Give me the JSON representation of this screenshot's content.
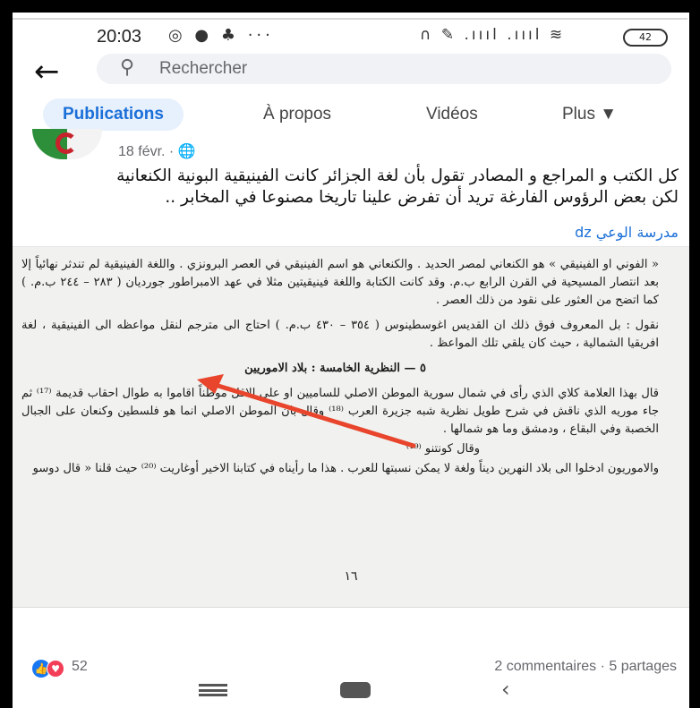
{
  "status_bar": {
    "time": "20:03",
    "left_icons": "◎ ● ♣ ···",
    "right_icons": "∩ ✎ .ıııl .ıııl ≋",
    "battery": "42"
  },
  "search": {
    "back_icon": "←",
    "search_icon": "⚲",
    "placeholder": "Rechercher"
  },
  "tabs": [
    {
      "label": "Publications"
    },
    {
      "label": "À propos"
    },
    {
      "label": "Vidéos"
    },
    {
      "label": "Plus ▼"
    }
  ],
  "post": {
    "date": "18 févr. · 🌐",
    "text": "كل الكتب و المراجع و المصادر تقول بأن لغة الجزائر كانت الفينيقية البونية الكنعانية لكن بعض الرؤوس الفارغة تريد أن تفرض علينا تاريخا مصنوعا في المخابر ..",
    "link": "مدرسة الوعي dz"
  },
  "book_page": {
    "paragraphs": [
      "« الفوني او الفينيقي » هو الكنعاني لمصر الحديد . والكنعاني هو اسم الفينيقي في العصر البرونزي . واللغة الفينيقية لم تندثر نهائياً إلا بعد انتصار المسيحية في القرن الرابع ب.م. وقد كانت الكتابة واللغة فينيقيتين مثلا في عهد الامبراطور جورديان ( ٢٨٣ – ٢٤٤ ب.م. ) كما اتضح من العثور على نقود من ذلك العصر .",
      "نقول : بل المعروف فوق ذلك ان القديس اغوسطينوس ( ٣٥٤ – ٤٣٠ ب.م. ) احتاج الى مترجم لنقل مواعظه الى الفينيقية ، لغة افريقيا الشمالية ، حيث كان يلقي تلك المواعظ ."
    ],
    "heading": "٥ — النظرية الخامسة : بلاد الاموريين",
    "paragraphs2": [
      "قال بهذا العلامة كلاي الذي رأى في شمال سورية الموطن الاصلي للساميين او على الاقل موطناً اقاموا به طوال احقاب قديمة ⁽¹⁷⁾ ثم جاء موريه الذي ناقش في شرح طويل نظرية شبه جزيرة العرب ⁽¹⁸⁾ وقال بان الموطن الاصلي انما هو فلسطين وكنعان على الجبال الخصبة وفي البقاع ، ودمشق وما هو شمالها .",
      "وقال كونتنو ⁽¹⁹⁾",
      "والاموريون ادخلوا الى بلاد النهرين ديناً ولغة لا يمكن نسبتها للعرب . هذا ما رأيناه في كتابنا الاخير أوغاريت ⁽²⁰⁾ حيث قلنا « قال دوسو"
    ],
    "page_number": "١٦"
  },
  "reactions": {
    "like_glyph": "👍",
    "love_glyph": "♥",
    "count": "52",
    "stats": "2 commentaires · 5 partages"
  },
  "colors": {
    "accent": "#1b6fd8",
    "tab_active_bg": "#e7f0fd",
    "arrow": "#e8452c"
  }
}
